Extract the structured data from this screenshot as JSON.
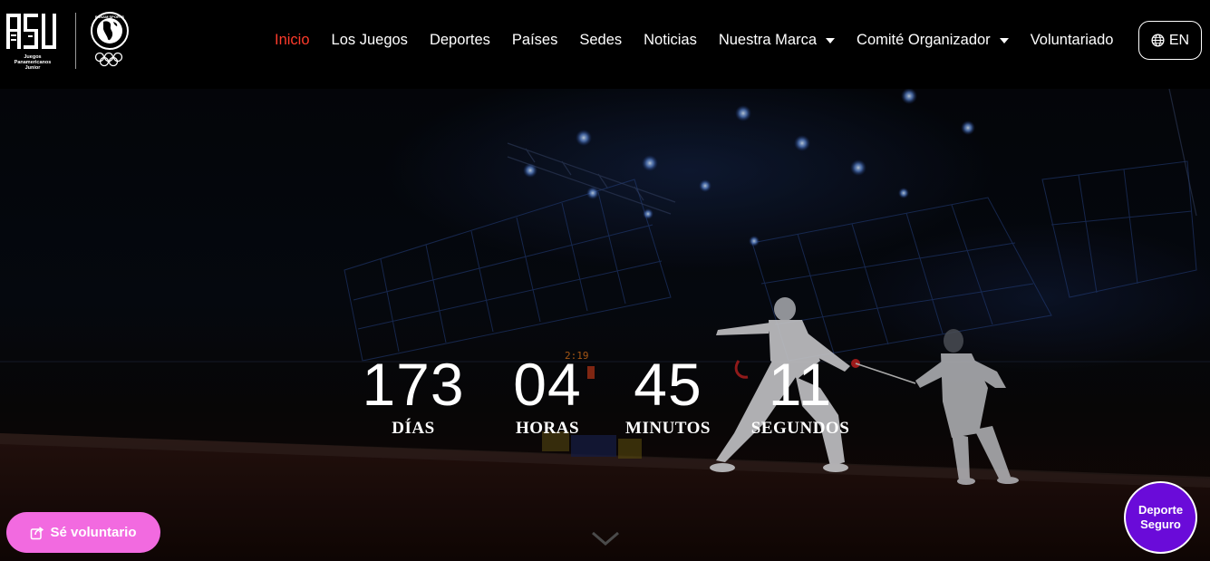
{
  "header": {
    "logo": {
      "mark": "ASU",
      "caption_line1": "Juegos Panamericanos",
      "caption_line2": "Junior",
      "partner_text": "PANAM SPORTS"
    },
    "nav": [
      {
        "label": "Inicio",
        "active": true,
        "dropdown": false
      },
      {
        "label": "Los Juegos",
        "active": false,
        "dropdown": false
      },
      {
        "label": "Deportes",
        "active": false,
        "dropdown": false
      },
      {
        "label": "Países",
        "active": false,
        "dropdown": false
      },
      {
        "label": "Sedes",
        "active": false,
        "dropdown": false
      },
      {
        "label": "Noticias",
        "active": false,
        "dropdown": false
      },
      {
        "label": "Nuestra Marca",
        "active": false,
        "dropdown": true
      },
      {
        "label": "Comité Organizador",
        "active": false,
        "dropdown": true
      },
      {
        "label": "Voluntariado",
        "active": false,
        "dropdown": false
      }
    ],
    "language_button": {
      "label": "EN",
      "icon": "globe-icon"
    }
  },
  "hero": {
    "scoreboard_text": "2:19",
    "countdown": [
      {
        "value": "173",
        "label": "DÍAS"
      },
      {
        "value": "04",
        "label": "HORAS"
      },
      {
        "value": "45",
        "label": "MINUTOS"
      },
      {
        "value": "11",
        "label": "SEGUNDOS"
      }
    ],
    "scroll_icon": "chevron-down-icon"
  },
  "floating": {
    "volunteer_button": {
      "label": "Sé voluntario",
      "icon": "share-icon"
    },
    "safe_sport_button": {
      "line1": "Deporte",
      "line2": "Seguro"
    }
  },
  "colors": {
    "active_nav": "#ff3b2b",
    "volunteer_button": "#f26ae0",
    "safe_sport_button": "#6a0bd9",
    "background": "#000000"
  }
}
